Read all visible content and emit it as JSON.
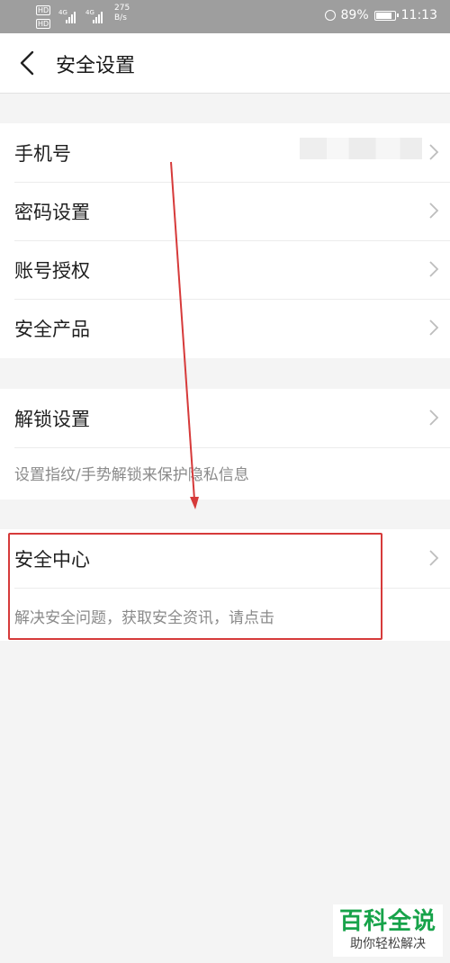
{
  "status_bar": {
    "hd1": "HD",
    "hd2": "HD",
    "signal1": "4G",
    "signal2": "4G",
    "speed_value": "275",
    "speed_unit": "B/s",
    "battery": "89%",
    "battery_level": 0.89,
    "time": "11:13"
  },
  "header": {
    "title": "安全设置"
  },
  "group1": [
    {
      "label": "手机号"
    },
    {
      "label": "密码设置"
    },
    {
      "label": "账号授权"
    },
    {
      "label": "安全产品"
    }
  ],
  "group2": {
    "label": "解锁设置",
    "description": "设置指纹/手势解锁来保护隐私信息"
  },
  "group3": {
    "label": "安全中心",
    "description": "解决安全问题，获取安全资讯，请点击"
  },
  "watermark": {
    "title": "百科全说",
    "subtitle": "助你轻松解决"
  },
  "colors": {
    "annotation_red": "#d63a3a",
    "watermark_green": "#17a34a"
  }
}
